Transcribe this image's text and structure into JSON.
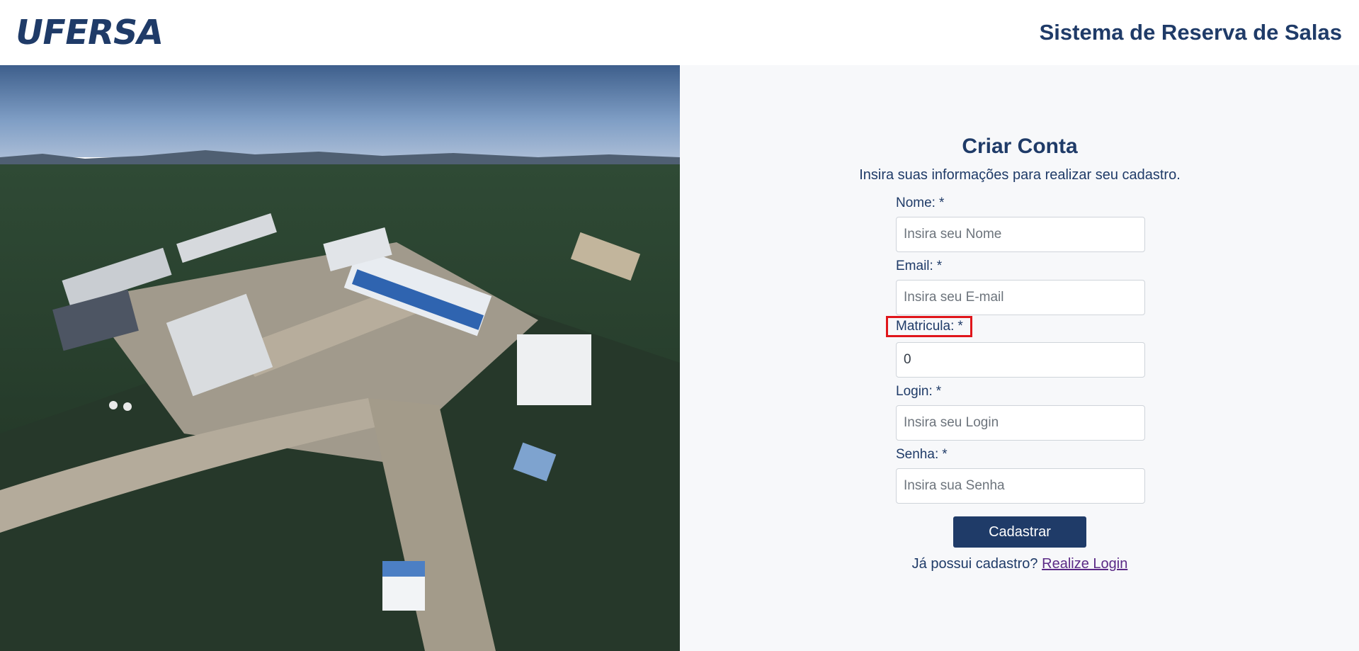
{
  "header": {
    "logo_text": "UFERSA",
    "app_title": "Sistema de Reserva de Salas"
  },
  "form": {
    "title": "Criar Conta",
    "subtitle": "Insira suas informações para realizar seu cadastro.",
    "required_mark": "*",
    "fields": [
      {
        "label": "Nome:",
        "placeholder": "Insira seu Nome",
        "value": ""
      },
      {
        "label": "Email:",
        "placeholder": "Insira seu E-mail",
        "value": ""
      },
      {
        "label": "Matricula:",
        "placeholder": "",
        "value": "0"
      },
      {
        "label": "Login:",
        "placeholder": "Insira seu Login",
        "value": ""
      },
      {
        "label": "Senha:",
        "placeholder": "Insira sua Senha",
        "value": ""
      }
    ],
    "submit_label": "Cadastrar",
    "login_prompt": "Já possui cadastro?",
    "login_link": "Realize Login"
  },
  "colors": {
    "brand": "#1f3b68",
    "highlight": "#e0161b",
    "link": "#5b2a86",
    "panel_bg": "#f7f8fa"
  }
}
